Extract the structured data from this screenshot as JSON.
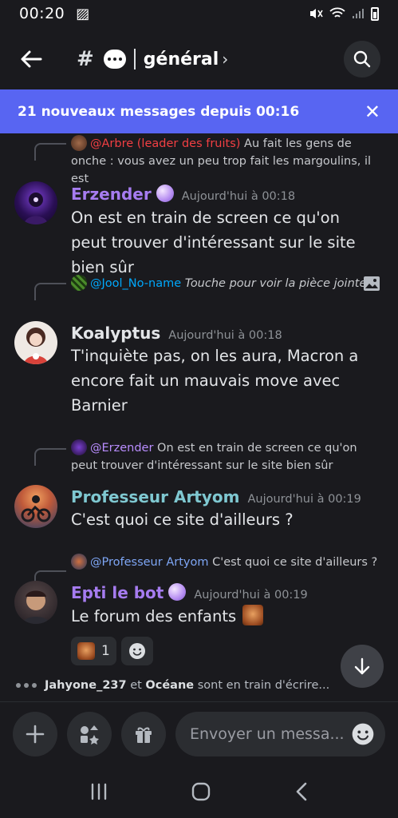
{
  "status": {
    "time": "00:20"
  },
  "header": {
    "channel": "général"
  },
  "banner": {
    "text": "21 nouveaux messages depuis 00:16"
  },
  "messages": [
    {
      "reply_to": {
        "mention": "@Arbre (leader des fruits)",
        "text": "Au fait les gens de onche : vous avez un peu trop fait les margoulins, il est"
      },
      "author": "Erzender",
      "timestamp": "Aujourd'hui à 00:18",
      "content": "On est en train de screen ce qu'on peut trouver d'intéressant sur le site bien sûr"
    },
    {
      "reply_to": {
        "mention": "@Jool_No-name",
        "text": "Touche pour voir la pièce jointe"
      },
      "author": "Koalyptus",
      "timestamp": "Aujourd'hui à 00:18",
      "content": "T'inquiète pas, on les aura, Macron a encore fait un mauvais move avec Barnier"
    },
    {
      "reply_to": {
        "mention": "@Erzender",
        "text": "On est en train de screen ce qu'on peut trouver d'intéressant sur le site bien sûr"
      },
      "author": "Professeur Artyom",
      "timestamp": "Aujourd'hui à 00:19",
      "content": "C'est quoi ce site d'ailleurs ?"
    },
    {
      "reply_to": {
        "mention": "@Professeur Artyom",
        "text": "C'est quoi ce site d'ailleurs ?"
      },
      "author": "Epti le bot",
      "timestamp": "Aujourd'hui à 00:19",
      "content": "Le forum des enfants",
      "reaction_count": "1"
    }
  ],
  "typing": {
    "user1": "Jahyone_237",
    "conj": "et",
    "user2": "Océane",
    "suffix": "sont en train d'écrire..."
  },
  "composer": {
    "placeholder": "Envoyer un messa..."
  },
  "colors": {
    "accent": "#5865f2",
    "bg": "#1a1a1e",
    "erzender": "#a67cf0",
    "koalyptus": "#e3e5e8",
    "artyom": "#7fc8d1",
    "epti": "#a67cf0"
  }
}
